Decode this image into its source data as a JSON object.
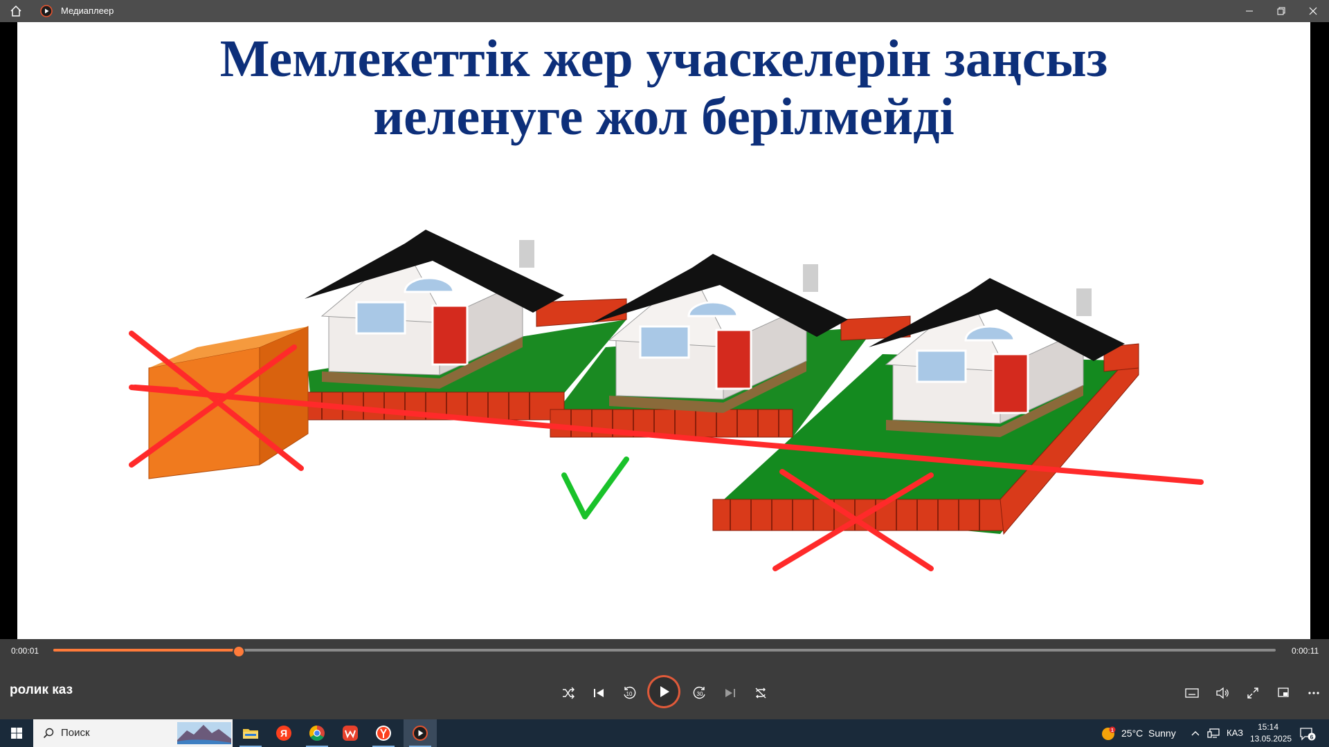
{
  "window": {
    "title": "Медиаплеер",
    "icons": {
      "home": "home-icon",
      "app": "media-player-icon",
      "minimize": "minimize-icon",
      "restore": "restore-icon",
      "close": "close-icon"
    }
  },
  "video": {
    "title_line1": "Мемлекеттік жер учаскелерін заңсыз",
    "title_line2": "иеленуге жол берілмейді",
    "title_color": "#0d2f7a",
    "marks": {
      "cross_color": "#ff2a2a",
      "check_color": "#19c22a"
    }
  },
  "player": {
    "time_current": "0:00:01",
    "time_total": "0:00:11",
    "progress_fraction": 0.151,
    "media_name": "ролик каз",
    "accent": "#ff7b3a",
    "buttons": [
      "shuffle-icon",
      "previous-icon",
      "rewind-10-icon",
      "play-icon",
      "forward-30-icon",
      "next-icon",
      "repeat-off-icon",
      "captions-icon",
      "volume-icon",
      "fullscreen-icon",
      "mini-player-icon",
      "more-icon"
    ],
    "rewind_label": "10",
    "forward_label": "30"
  },
  "taskbar": {
    "search_placeholder": "Поиск",
    "apps": [
      "file-explorer-icon",
      "yandex-icon",
      "chrome-icon",
      "wps-icon",
      "yandex-browser-icon",
      "media-player-icon"
    ],
    "weather_temp": "25°C",
    "weather_cond": "Sunny",
    "weather_badge": "1",
    "language": "КАЗ",
    "time": "15:14",
    "date": "13.05.2025",
    "notifications": "6"
  }
}
